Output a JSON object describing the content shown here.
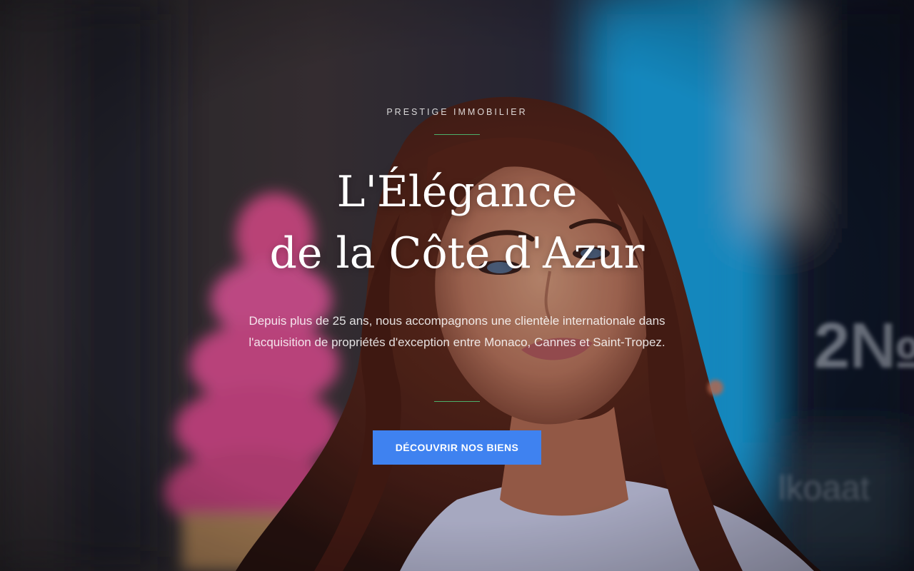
{
  "hero": {
    "eyebrow": "PRESTIGE IMMOBILIER",
    "title_line1": "L'Élégance",
    "title_line2": "de la Côte d'Azur",
    "description": "Depuis plus de 25 ans, nous accompagnons une clientèle internationale dans l'acquisition de propriétés d'exception entre Monaco, Cannes et Saint-Tropez.",
    "cta_label": "DÉCOUVRIR NOS BIENS",
    "background_image": "woman-portrait-photo"
  },
  "colors": {
    "accent_rule": "#4caf6a",
    "button": "#3f82f0",
    "text": "#ffffff"
  }
}
